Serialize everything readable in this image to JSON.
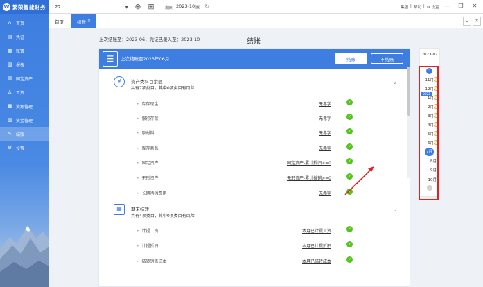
{
  "app": {
    "logo_mark": "W",
    "logo_text": "繁荣智能财务"
  },
  "top": {
    "account": "22",
    "period_label": "期间",
    "period_value": "2023-10",
    "links": [
      "集团",
      "帮助",
      "设置"
    ],
    "icons": {
      "add": "plus-circle-icon",
      "grid": "grid-icon",
      "calendar": "calendar-icon",
      "refresh": "refresh-icon"
    }
  },
  "window": {
    "minimize": "—",
    "restore": "❐",
    "close": "✕"
  },
  "sidebar": {
    "items": [
      {
        "label": "首页",
        "icon": "⌂"
      },
      {
        "label": "凭证",
        "icon": "▤"
      },
      {
        "label": "账簿",
        "icon": "▦"
      },
      {
        "label": "报表",
        "icon": "▧"
      },
      {
        "label": "固定资产",
        "icon": "▥"
      },
      {
        "label": "工资",
        "icon": "♙"
      },
      {
        "label": "资源管理",
        "icon": "▩"
      },
      {
        "label": "资金管理",
        "icon": "▨"
      },
      {
        "label": "结账",
        "icon": "✎"
      },
      {
        "label": "设置",
        "icon": "⚙"
      }
    ]
  },
  "tabs": {
    "home": "首页",
    "active": "结账",
    "close": "✕",
    "refresh": "C",
    "close_all": "✕"
  },
  "content": {
    "last_info": "上次结账至：2023-06，凭证已录入至：2023-10",
    "title": "结账"
  },
  "panel": {
    "head_text": "上次结账至2023年06月",
    "btn_close": "结账",
    "btn_unclose": "不结账",
    "sections": [
      {
        "title": "资产类科目余额",
        "subtitle": "共有7项类目，其中0项类目有风险",
        "icon": "¥",
        "rows": [
          {
            "name": "库存现金",
            "status": "无赤字"
          },
          {
            "name": "银行存款",
            "status": "无赤字"
          },
          {
            "name": "原材料",
            "status": "无赤字"
          },
          {
            "name": "库存商品",
            "status": "无赤字"
          },
          {
            "name": "固定资产",
            "status": "固定资产-累计折旧>=0"
          },
          {
            "name": "无形资产",
            "status": "无形资产-累计摊销>=0"
          },
          {
            "name": "长期待摊费用",
            "status": "无赤字"
          }
        ]
      },
      {
        "title": "期末结转",
        "subtitle": "共有4项类目，其中0项类目有风险",
        "icon": "▦",
        "rows": [
          {
            "name": "计提工资",
            "status": "本月已计提工资"
          },
          {
            "name": "计提折旧",
            "status": "本月已计提折旧"
          },
          {
            "name": "结转销售成本",
            "status": "本月已结转成本"
          }
        ]
      }
    ]
  },
  "months": {
    "year": "2023-07",
    "up": "⌃",
    "year_tag": "2023",
    "list": [
      {
        "label": "11月",
        "state": "ok"
      },
      {
        "label": "12月",
        "state": "ok"
      },
      {
        "label": "1月",
        "state": "ok"
      },
      {
        "label": "2月",
        "state": "ok"
      },
      {
        "label": "3月",
        "state": "ok"
      },
      {
        "label": "4月",
        "state": "ok"
      },
      {
        "label": "5月",
        "state": "ok"
      },
      {
        "label": "6月",
        "state": "ok"
      },
      {
        "label": "7月",
        "state": "current"
      },
      {
        "label": "8月",
        "state": "plain"
      },
      {
        "label": "9月",
        "state": "plain"
      },
      {
        "label": "10月",
        "state": "plain"
      }
    ],
    "down": "⌄"
  },
  "colors": {
    "primary": "#3d7ee0",
    "success": "#52c41a",
    "warning": "#e7a92a",
    "highlight": "#e52222"
  }
}
